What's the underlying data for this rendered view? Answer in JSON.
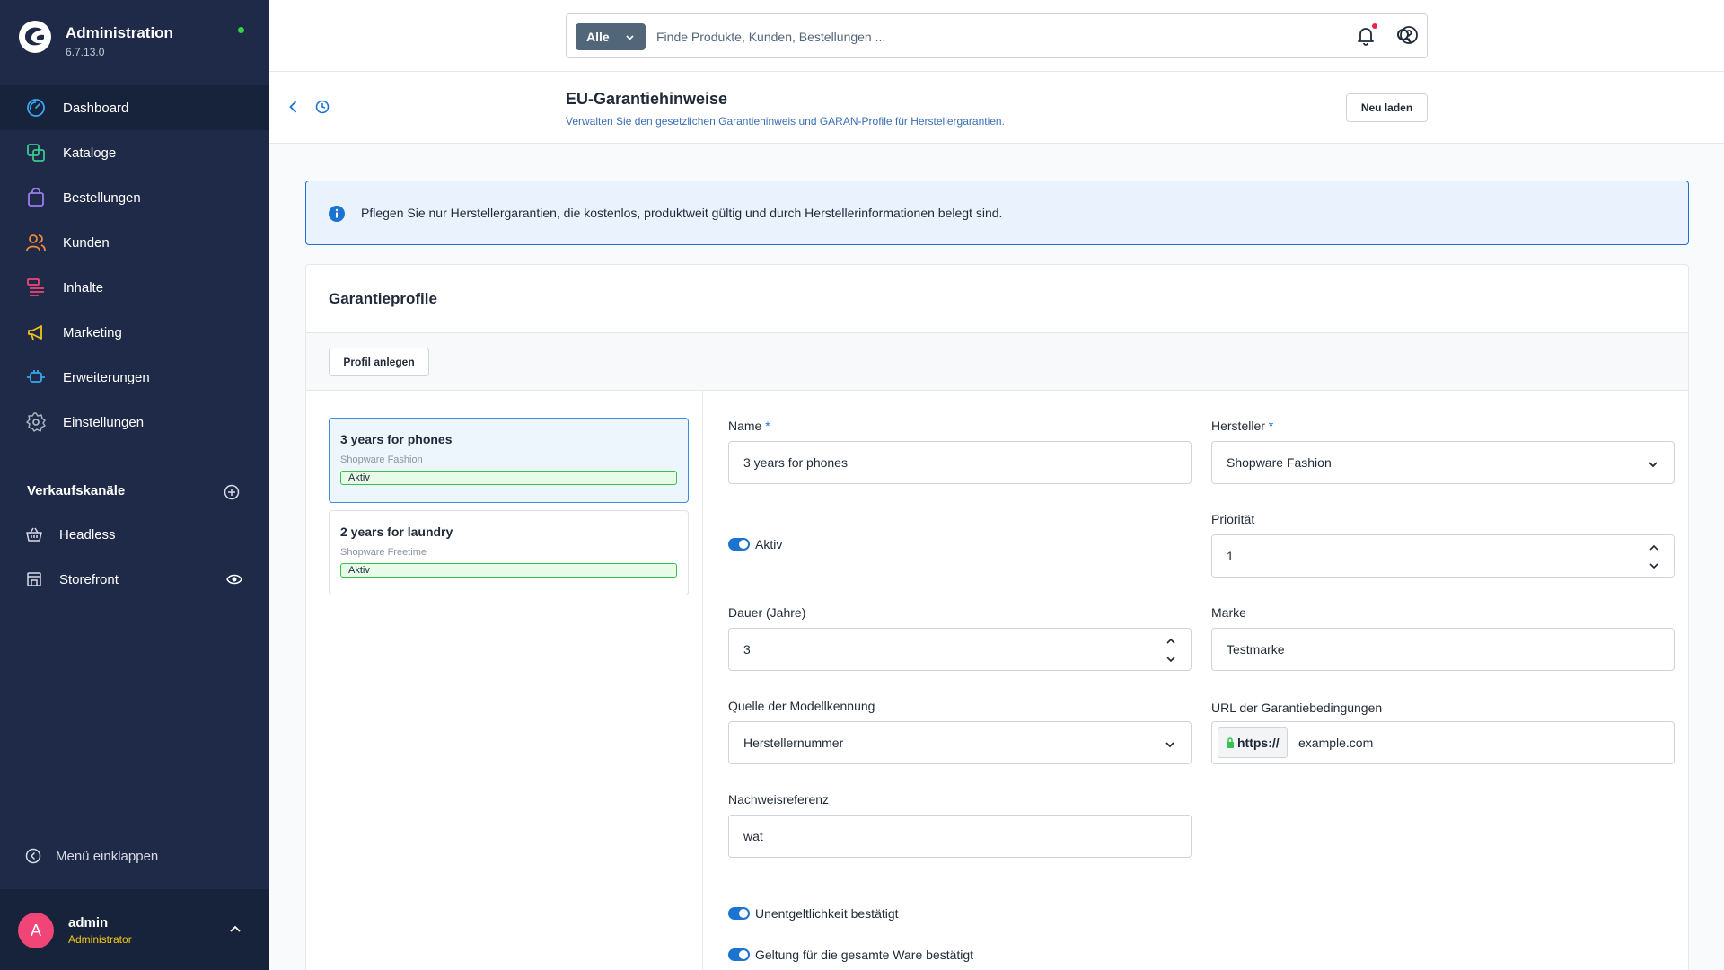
{
  "app": {
    "title": "Administration",
    "version": "6.7.13.0"
  },
  "sidebar": {
    "items": [
      {
        "label": "Dashboard",
        "icon": "dashboard-icon",
        "active": true
      },
      {
        "label": "Kataloge",
        "icon": "catalog-icon"
      },
      {
        "label": "Bestellungen",
        "icon": "orders-icon"
      },
      {
        "label": "Kunden",
        "icon": "customers-icon"
      },
      {
        "label": "Inhalte",
        "icon": "content-icon"
      },
      {
        "label": "Marketing",
        "icon": "marketing-icon"
      },
      {
        "label": "Erweiterungen",
        "icon": "extensions-icon"
      },
      {
        "label": "Einstellungen",
        "icon": "settings-icon"
      }
    ],
    "sales_channels_title": "Verkaufskanäle",
    "sales_channels": [
      {
        "label": "Headless",
        "icon": "basket-icon"
      },
      {
        "label": "Storefront",
        "icon": "storefront-icon"
      }
    ],
    "collapse_label": "Menü einklappen",
    "user": {
      "initial": "A",
      "name": "admin",
      "role": "Administrator"
    }
  },
  "search": {
    "type_label": "Alle",
    "placeholder": "Finde Produkte, Kunden, Bestellungen ..."
  },
  "page": {
    "title": "EU-Garantiehinweise",
    "subtitle": "Verwalten Sie den gesetzlichen Garantiehinweis und GARAN-Profile für Herstellergarantien.",
    "reload_label": "Neu laden"
  },
  "alert": {
    "text": "Pflegen Sie nur Herstellergarantien, die kostenlos, produktweit gültig und durch Herstellerinformationen belegt sind."
  },
  "card": {
    "title": "Garantieprofile",
    "create_label": "Profil anlegen"
  },
  "profiles": [
    {
      "name": "3 years for phones",
      "manufacturer": "Shopware Fashion",
      "status": "Aktiv",
      "selected": true
    },
    {
      "name": "2 years for laundry",
      "manufacturer": "Shopware Freetime",
      "status": "Aktiv",
      "selected": false
    }
  ],
  "form": {
    "name": {
      "label": "Name",
      "required": "*",
      "value": "3 years for phones"
    },
    "manufacturer": {
      "label": "Hersteller",
      "required": "*",
      "value": "Shopware Fashion"
    },
    "active": {
      "label": "Aktiv",
      "on": true
    },
    "priority": {
      "label": "Priorität",
      "value": "1"
    },
    "duration": {
      "label": "Dauer (Jahre)",
      "value": "3"
    },
    "brand": {
      "label": "Marke",
      "value": "Testmarke"
    },
    "model_source": {
      "label": "Quelle der Modellkennung",
      "value": "Herstellernummer"
    },
    "terms_url": {
      "label": "URL der Garantiebedingungen",
      "prefix": "https://",
      "value": "example.com"
    },
    "evidence": {
      "label": "Nachweisreferenz",
      "value": "wat"
    },
    "free_confirmed": {
      "label": "Unentgeltlichkeit bestätigt",
      "on": true
    },
    "all_goods_confirmed": {
      "label": "Geltung für die gesamte Ware bestätigt",
      "on": true
    }
  },
  "colors": {
    "sidebar": "#1e2a47",
    "accent": "#1a74d0",
    "success": "#37c14a",
    "avatar": "#f04576",
    "role": "#f5c518"
  }
}
